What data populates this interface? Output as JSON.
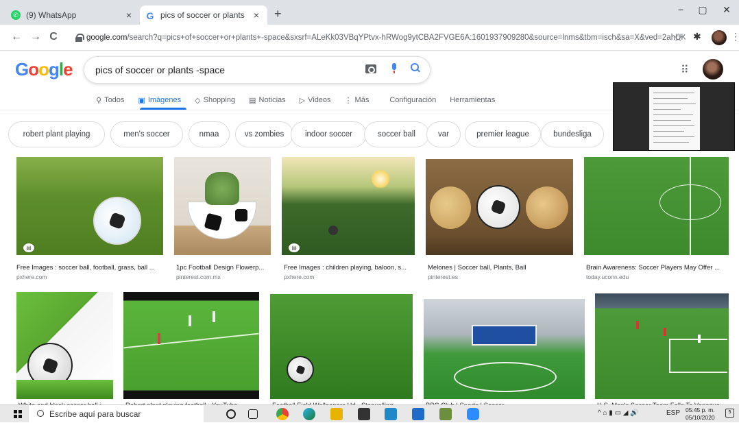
{
  "browser": {
    "tabs": [
      {
        "title": "(9) WhatsApp",
        "close": "×"
      },
      {
        "title": "pics of soccer or plants -space - ",
        "close": "×"
      }
    ],
    "new_tab": "+",
    "window": {
      "minimize": "−",
      "maximize": "▢",
      "close": "✕"
    },
    "nav": {
      "back": "←",
      "forward": "→",
      "reload": "C"
    },
    "address": {
      "host": "google.com",
      "path": "/search?q=pics+of+soccer+or+plants+-space&sxsrf=ALeKk03VBqYPtvx-hRWog9ytCBA2FVGE6A:1601937909280&source=lnms&tbm=isch&sa=X&ved=2ahUKE..."
    },
    "star": "☆",
    "extensions": "✱",
    "menu": "⋮"
  },
  "google": {
    "logo": [
      "G",
      "o",
      "o",
      "g",
      "l",
      "e"
    ],
    "logo_colors": [
      "#4285f4",
      "#ea4335",
      "#fbbc05",
      "#4285f4",
      "#34a853",
      "#ea4335"
    ],
    "query": "pics of soccer or plants -space",
    "apps": "⋮⋮⋮",
    "tabs": [
      {
        "label": "Todos",
        "icon": "⚲"
      },
      {
        "label": "Imágenes",
        "icon": "▣"
      },
      {
        "label": "Shopping",
        "icon": "◇"
      },
      {
        "label": "Noticias",
        "icon": "▤"
      },
      {
        "label": "Videos",
        "icon": "▷"
      },
      {
        "label": "Más",
        "icon": "⋮"
      },
      {
        "label": "Configuración",
        "icon": ""
      },
      {
        "label": "Herramientas",
        "icon": ""
      }
    ],
    "accent": "#1a73e8"
  },
  "chips": [
    "robert plant playing",
    "men's soccer",
    "nmaa",
    "vs zombies",
    "indoor soccer",
    "soccer ball",
    "var",
    "premier league",
    "bundesliga"
  ],
  "results_row1": [
    {
      "title": "Free Images : soccer ball, football, grass, ball ...",
      "source": "pxhere.com"
    },
    {
      "title": "1pc Football Design Flowerp...",
      "source": "pinterest.com.mx"
    },
    {
      "title": "Free Images : children playing, baloon, s...",
      "source": "pxhere.com"
    },
    {
      "title": "Melones | Soccer ball, Plants, Ball",
      "source": "pinterest.es"
    },
    {
      "title": "Brain Awareness: Soccer Players May Offer ...",
      "source": "today.uconn.edu"
    }
  ],
  "results_row2": [
    {
      "title": "White and black soccer ball i..."
    },
    {
      "title": "Robert plant playing football - YouTube"
    },
    {
      "title": "Football Field Wallpapers Hd - Starwalling"
    },
    {
      "title": "BBC Club | Sports | Soccer"
    },
    {
      "title": "U.S. Men's Soccer Team Falls To Venezue..."
    }
  ],
  "taskbar": {
    "search_placeholder": "Escribe aquí para buscar",
    "lang": "ESP",
    "time": "05:45 p. m.",
    "date": "05/10/2020",
    "notifications": "5",
    "tray_icons": "^ ⌂ ▮ ▭ ◢ 🔊"
  }
}
